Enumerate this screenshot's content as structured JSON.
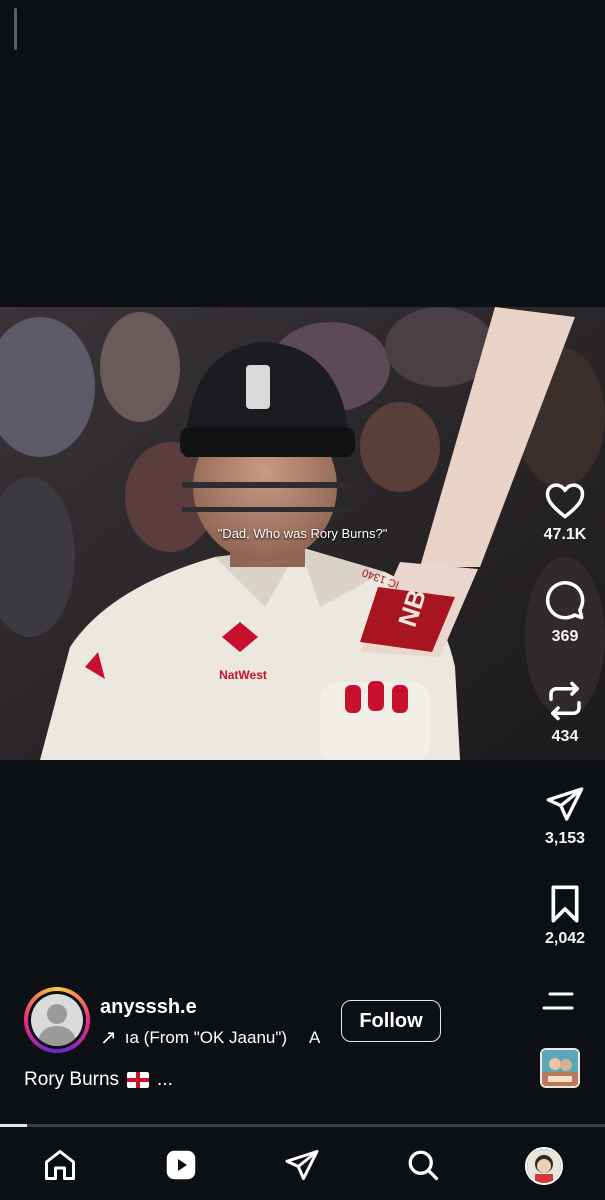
{
  "video": {
    "caption": "\"Dad, Who was Rory Burns?\"",
    "jersey_sponsor": "NatWest",
    "bat_text": "IC 1340"
  },
  "actions": {
    "like_count": "47.1K",
    "comment_count": "369",
    "repost_count": "434",
    "share_count": "3,153",
    "save_count": "2,042"
  },
  "author": {
    "username": "anysssh.e",
    "audio_arrow": "↗",
    "audio_text": "ıa (From \"OK Jaanu\")",
    "audio_extra": "A",
    "follow_label": "Follow"
  },
  "post": {
    "caption": "Rory Burns",
    "caption_more": "..."
  },
  "playback": {
    "progress": 0.045
  },
  "nav": {
    "icons": [
      "home-icon",
      "reels-icon",
      "direct-icon",
      "search-icon",
      "profile-avatar"
    ]
  },
  "colors": {
    "background": "#0c1014",
    "text": "#ffffff",
    "england_red": "#c8102e"
  }
}
